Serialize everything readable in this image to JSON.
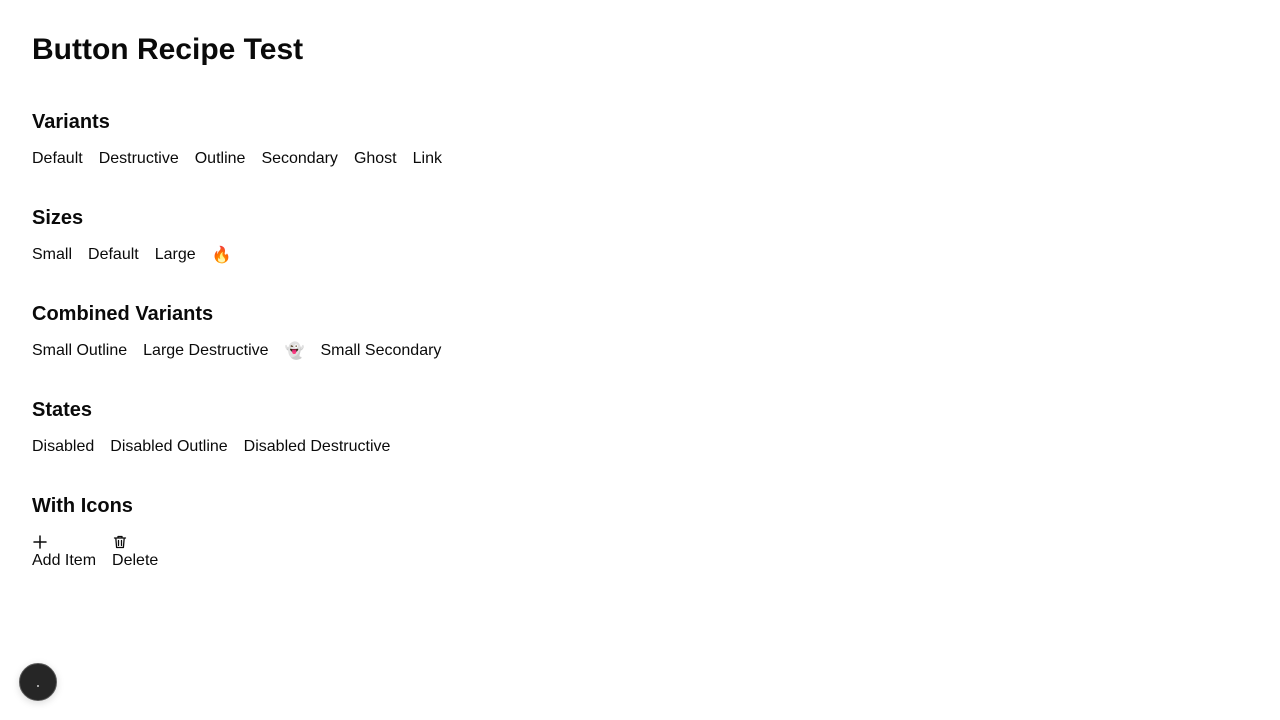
{
  "page": {
    "title": "Button Recipe Test"
  },
  "sections": {
    "variants": {
      "heading": "Variants",
      "buttons": [
        "Default",
        "Destructive",
        "Outline",
        "Secondary",
        "Ghost",
        "Link"
      ]
    },
    "sizes": {
      "heading": "Sizes",
      "buttons": [
        "Small",
        "Default",
        "Large"
      ],
      "icon_button_glyph": "🔥",
      "icon_button_icon": "fire-icon"
    },
    "combined": {
      "heading": "Combined Variants",
      "buttons": [
        "Small Outline",
        "Large Destructive"
      ],
      "icon_button_glyph": "👻",
      "icon_button_icon": "ghost-icon",
      "last_button": "Small Secondary"
    },
    "states": {
      "heading": "States",
      "buttons": [
        "Disabled",
        "Disabled Outline",
        "Disabled Destructive"
      ]
    },
    "with_icons": {
      "heading": "With Icons",
      "add": {
        "label": "Add Item",
        "icon": "plus-icon"
      },
      "delete": {
        "label": "Delete",
        "icon": "trash-icon"
      }
    }
  },
  "floating_button": {
    "icon": "dev-tools-icon",
    "color": "#262626"
  }
}
